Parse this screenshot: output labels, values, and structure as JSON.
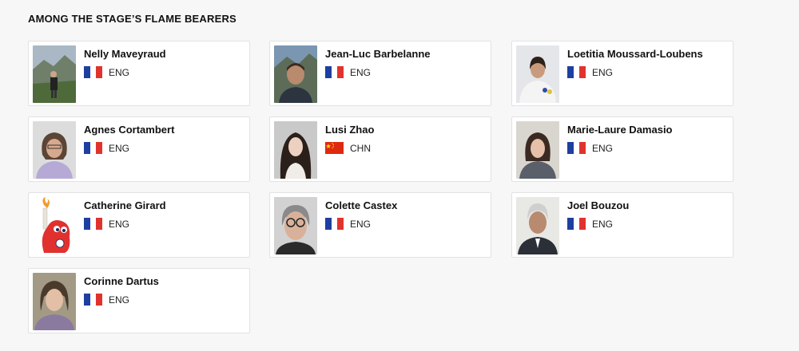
{
  "section": {
    "title": "AMONG THE STAGE’S FLAME BEARERS"
  },
  "colors": {
    "france_blue": "#1d3fa0",
    "france_red": "#e1332d",
    "china_red": "#de2910"
  },
  "bearers": [
    {
      "name": "Nelly Maveyraud",
      "country": "ENG",
      "flag": "france-flag-icon"
    },
    {
      "name": "Jean-Luc Barbelanne",
      "country": "ENG",
      "flag": "france-flag-icon"
    },
    {
      "name": "Loetitia Moussard-Loubens",
      "country": "ENG",
      "flag": "france-flag-icon"
    },
    {
      "name": "Agnes Cortambert",
      "country": "ENG",
      "flag": "france-flag-icon"
    },
    {
      "name": "Lusi Zhao",
      "country": "CHN",
      "flag": "china-flag-icon"
    },
    {
      "name": "Marie-Laure Damasio",
      "country": "ENG",
      "flag": "france-flag-icon"
    },
    {
      "name": "Catherine Girard",
      "country": "ENG",
      "flag": "france-flag-icon"
    },
    {
      "name": "Colette Castex",
      "country": "ENG",
      "flag": "france-flag-icon"
    },
    {
      "name": "Joel Bouzou",
      "country": "ENG",
      "flag": "france-flag-icon"
    },
    {
      "name": "Corinne Dartus",
      "country": "ENG",
      "flag": "france-flag-icon"
    }
  ]
}
